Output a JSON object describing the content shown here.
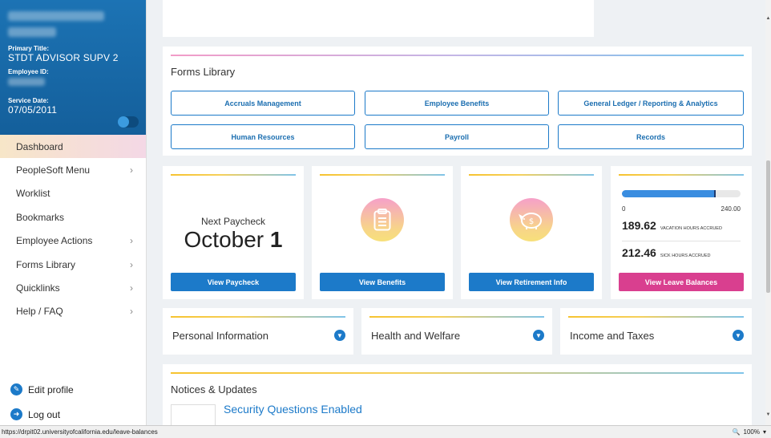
{
  "sidebar": {
    "primary_title_label": "Primary Title:",
    "primary_title_value": "STDT ADVISOR SUPV 2",
    "employee_id_label": "Employee ID:",
    "service_date_label": "Service Date:",
    "service_date_value": "07/05/2011",
    "nav": [
      {
        "label": "Dashboard",
        "chevron": ""
      },
      {
        "label": "PeopleSoft Menu",
        "chevron": "›"
      },
      {
        "label": "Worklist",
        "chevron": ""
      },
      {
        "label": "Bookmarks",
        "chevron": ""
      },
      {
        "label": "Employee Actions",
        "chevron": "›"
      },
      {
        "label": "Forms Library",
        "chevron": "›"
      },
      {
        "label": "Quicklinks",
        "chevron": "›"
      },
      {
        "label": "Help / FAQ",
        "chevron": "›"
      }
    ],
    "edit_profile": "Edit profile",
    "log_out": "Log out"
  },
  "forms_library": {
    "title": "Forms Library",
    "buttons": [
      "Accruals Management",
      "Employee Benefits",
      "General Ledger / Reporting & Analytics",
      "Human Resources",
      "Payroll",
      "Records"
    ]
  },
  "paycheck": {
    "label": "Next Paycheck",
    "month": "October",
    "day": "1",
    "button": "View Paycheck"
  },
  "benefits": {
    "button": "View Benefits",
    "icon": "clipboard-icon"
  },
  "retirement": {
    "button": "View Retirement Info",
    "icon": "piggy-bank-icon"
  },
  "leave": {
    "scale_min": "0",
    "scale_max": "240.00",
    "fill_fraction": 0.79,
    "vacation_hours": "189.62",
    "vacation_label": "VACATION HOURS ACCRUED",
    "sick_hours": "212.46",
    "sick_label": "SICK HOURS ACCRUED",
    "button": "View Leave Balances"
  },
  "accordions": [
    "Personal Information",
    "Health and Welfare",
    "Income and Taxes"
  ],
  "notices": {
    "title": "Notices & Updates",
    "first_item": "Security Questions Enabled"
  },
  "statusbar": {
    "url": "https://drpit02.universityofcalifornia.edu/leave-balances",
    "zoom": "100%"
  },
  "colors": {
    "primary": "#1c7ac9",
    "leave_button": "#d93f8f",
    "sidebar_header": "#1c73b4"
  }
}
